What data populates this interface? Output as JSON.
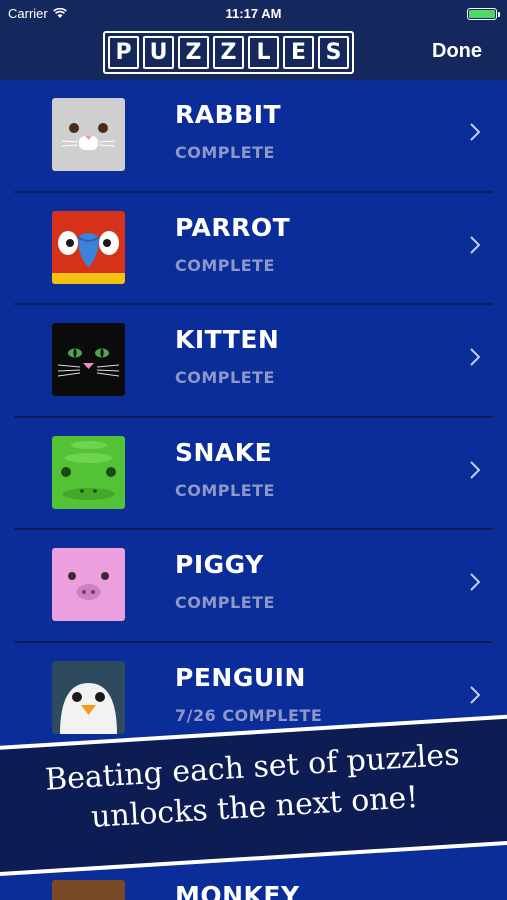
{
  "status": {
    "carrier": "Carrier",
    "time": "11:17 AM"
  },
  "nav": {
    "logo_letters": [
      "P",
      "U",
      "Z",
      "Z",
      "L",
      "E",
      "S"
    ],
    "done_label": "Done"
  },
  "puzzles": [
    {
      "name": "RABBIT",
      "status": "COMPLETE",
      "icon": "rabbit-icon"
    },
    {
      "name": "PARROT",
      "status": "COMPLETE",
      "icon": "parrot-icon"
    },
    {
      "name": "KITTEN",
      "status": "COMPLETE",
      "icon": "kitten-icon"
    },
    {
      "name": "SNAKE",
      "status": "COMPLETE",
      "icon": "snake-icon"
    },
    {
      "name": "PIGGY",
      "status": "COMPLETE",
      "icon": "pig-icon"
    },
    {
      "name": "PENGUIN",
      "status": "7/26 COMPLETE",
      "icon": "penguin-icon"
    }
  ],
  "next_item": {
    "name": "MONKEY",
    "icon": "monkey-icon"
  },
  "banner": {
    "line1": "Beating each set of puzzles",
    "line2": "unlocks the next one!"
  },
  "colors": {
    "background": "#0b2d9a",
    "header": "#14285e",
    "banner": "#0d1c52",
    "subtext": "#8d98c8"
  }
}
